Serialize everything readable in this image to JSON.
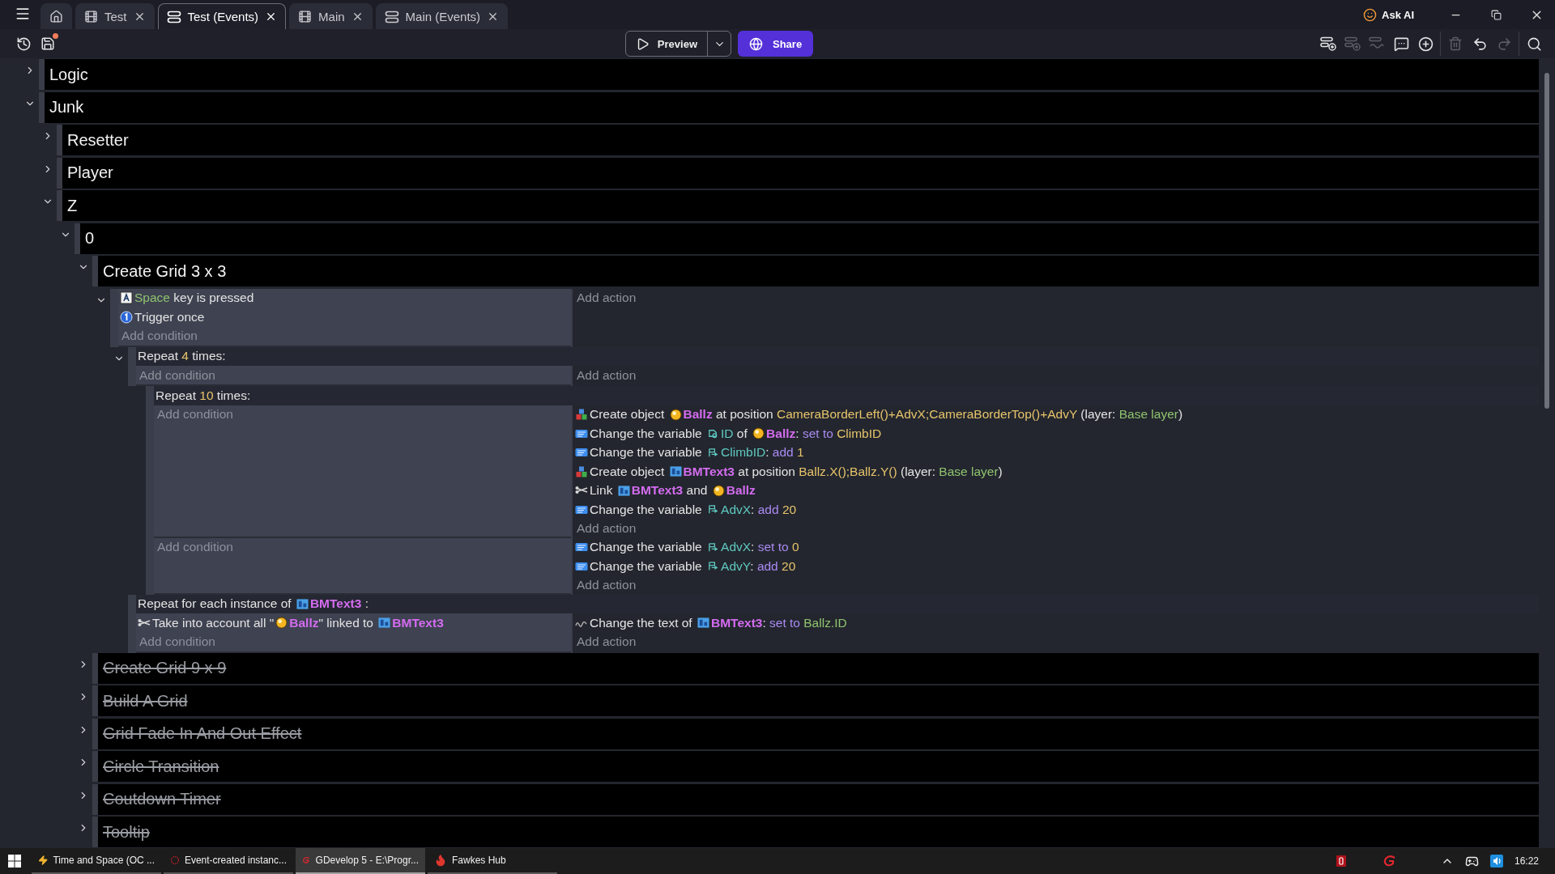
{
  "tabs": [
    {
      "kind": "home",
      "selected": false
    },
    {
      "kind": "scene",
      "label": "Test",
      "selected": false
    },
    {
      "kind": "events",
      "label": "Test (Events)",
      "selected": true
    },
    {
      "kind": "scene",
      "label": "Main",
      "selected": false
    },
    {
      "kind": "events",
      "label": "Main (Events)",
      "selected": false
    }
  ],
  "ask_ai": "Ask AI",
  "toolbar": {
    "unsaved": true,
    "preview": "Preview",
    "share": "Share",
    "tool_groups": [
      [
        {
          "kind": "add-event",
          "disabled": false
        },
        {
          "kind": "add-subevent",
          "disabled": true
        },
        {
          "kind": "add-other",
          "disabled": true
        },
        {
          "kind": "comment",
          "disabled": false
        },
        {
          "kind": "add",
          "disabled": false
        }
      ],
      [
        {
          "kind": "delete",
          "disabled": true
        },
        {
          "kind": "undo",
          "disabled": false
        },
        {
          "kind": "redo",
          "disabled": true
        }
      ],
      [
        {
          "kind": "search",
          "disabled": false
        }
      ]
    ]
  },
  "events": [
    {
      "kind": "group",
      "name": "Logic",
      "expanded": false,
      "disabled": false
    },
    {
      "kind": "group",
      "name": "Junk",
      "expanded": true,
      "disabled": false,
      "children": [
        {
          "kind": "group",
          "name": "Resetter",
          "expanded": false,
          "disabled": false
        },
        {
          "kind": "group",
          "name": "Player",
          "expanded": false,
          "disabled": false
        },
        {
          "kind": "group",
          "name": "Z",
          "expanded": true,
          "disabled": false,
          "children": [
            {
              "kind": "group",
              "name": "0",
              "expanded": true,
              "disabled": false,
              "children": [
                {
                  "kind": "group",
                  "name": "Create Grid 3 x 3",
                  "expanded": true,
                  "disabled": false,
                  "children": [
                    {
                      "kind": "event",
                      "expanded": true,
                      "add_condition": "Add condition",
                      "add_action": "Add action",
                      "conditions": [
                        {
                          "kind": "key",
                          "parts": [
                            {
                              "kind": "literal",
                              "text": "Space"
                            },
                            {
                              "kind": "text",
                              "text": " key is pressed"
                            }
                          ]
                        },
                        {
                          "kind": "trigger",
                          "parts": [
                            {
                              "kind": "text",
                              "text": "Trigger once"
                            }
                          ]
                        }
                      ],
                      "children": [
                        {
                          "kind": "event",
                          "expanded": true,
                          "add_condition": "Add condition",
                          "add_action": "Add action",
                          "header": [
                            {
                              "kind": "text",
                              "text": "Repeat "
                            },
                            {
                              "kind": "number",
                              "text": "4"
                            },
                            {
                              "kind": "text",
                              "text": " times:"
                            }
                          ],
                          "children": [
                            {
                              "kind": "event",
                              "add_condition": "Add condition",
                              "add_action": "Add action",
                              "header": [
                                {
                                  "kind": "text",
                                  "text": "Repeat "
                                },
                                {
                                  "kind": "number",
                                  "text": "10"
                                },
                                {
                                  "kind": "text",
                                  "text": " times:"
                                }
                              ],
                              "actions": [
                                {
                                  "kind": "create",
                                  "parts": [
                                    {
                                      "kind": "text",
                                      "text": "Create object "
                                    },
                                    {
                                      "kind": "sprite",
                                      "text": "Ballz"
                                    },
                                    {
                                      "kind": "text",
                                      "text": " at position "
                                    },
                                    {
                                      "kind": "expression",
                                      "text": "CameraBorderLeft()+AdvX;CameraBorderTop()+AdvY"
                                    },
                                    {
                                      "kind": "text",
                                      "text": " (layer: "
                                    },
                                    {
                                      "kind": "literal",
                                      "text": "Base layer"
                                    },
                                    {
                                      "kind": "text",
                                      "text": ")"
                                    }
                                  ]
                                },
                                {
                                  "kind": "variable",
                                  "parts": [
                                    {
                                      "kind": "text",
                                      "text": "Change the variable "
                                    },
                                    {
                                      "kind": "objvar",
                                      "text": "ID"
                                    },
                                    {
                                      "kind": "text",
                                      "text": " of "
                                    },
                                    {
                                      "kind": "sprite",
                                      "text": "Ballz"
                                    },
                                    {
                                      "kind": "text",
                                      "text": ": "
                                    },
                                    {
                                      "kind": "operator",
                                      "text": "set to "
                                    },
                                    {
                                      "kind": "expression",
                                      "text": "ClimbID"
                                    }
                                  ]
                                },
                                {
                                  "kind": "variable",
                                  "parts": [
                                    {
                                      "kind": "text",
                                      "text": "Change the variable "
                                    },
                                    {
                                      "kind": "scenevar",
                                      "text": "ClimbID"
                                    },
                                    {
                                      "kind": "text",
                                      "text": ": "
                                    },
                                    {
                                      "kind": "operator",
                                      "text": "add "
                                    },
                                    {
                                      "kind": "number",
                                      "text": "1"
                                    }
                                  ]
                                },
                                {
                                  "kind": "create",
                                  "parts": [
                                    {
                                      "kind": "text",
                                      "text": "Create object "
                                    },
                                    {
                                      "kind": "bmtext",
                                      "text": "BMText3"
                                    },
                                    {
                                      "kind": "text",
                                      "text": " at position "
                                    },
                                    {
                                      "kind": "expression",
                                      "text": "Ballz.X();Ballz.Y()"
                                    },
                                    {
                                      "kind": "text",
                                      "text": " (layer: "
                                    },
                                    {
                                      "kind": "literal",
                                      "text": "Base layer"
                                    },
                                    {
                                      "kind": "text",
                                      "text": ")"
                                    }
                                  ]
                                },
                                {
                                  "kind": "link",
                                  "parts": [
                                    {
                                      "kind": "text",
                                      "text": "Link "
                                    },
                                    {
                                      "kind": "bmtext",
                                      "text": "BMText3"
                                    },
                                    {
                                      "kind": "text",
                                      "text": " and "
                                    },
                                    {
                                      "kind": "sprite",
                                      "text": "Ballz"
                                    }
                                  ]
                                },
                                {
                                  "kind": "variable",
                                  "parts": [
                                    {
                                      "kind": "text",
                                      "text": "Change the variable "
                                    },
                                    {
                                      "kind": "scenevar",
                                      "text": "AdvX"
                                    },
                                    {
                                      "kind": "text",
                                      "text": ": "
                                    },
                                    {
                                      "kind": "operator",
                                      "text": "add "
                                    },
                                    {
                                      "kind": "number",
                                      "text": "20"
                                    }
                                  ]
                                }
                              ]
                            },
                            {
                              "kind": "event",
                              "add_condition": "Add condition",
                              "add_action": "Add action",
                              "actions": [
                                {
                                  "kind": "variable",
                                  "parts": [
                                    {
                                      "kind": "text",
                                      "text": "Change the variable "
                                    },
                                    {
                                      "kind": "scenevar",
                                      "text": "AdvX"
                                    },
                                    {
                                      "kind": "text",
                                      "text": ": "
                                    },
                                    {
                                      "kind": "operator",
                                      "text": "set to "
                                    },
                                    {
                                      "kind": "number",
                                      "text": "0"
                                    }
                                  ]
                                },
                                {
                                  "kind": "variable",
                                  "parts": [
                                    {
                                      "kind": "text",
                                      "text": "Change the variable "
                                    },
                                    {
                                      "kind": "scenevar",
                                      "text": "AdvY"
                                    },
                                    {
                                      "kind": "text",
                                      "text": ": "
                                    },
                                    {
                                      "kind": "operator",
                                      "text": "add "
                                    },
                                    {
                                      "kind": "number",
                                      "text": "20"
                                    }
                                  ]
                                }
                              ]
                            }
                          ]
                        },
                        {
                          "kind": "event",
                          "add_condition": "Add condition",
                          "add_action": "Add action",
                          "header": [
                            {
                              "kind": "text",
                              "text": "Repeat for each instance of "
                            },
                            {
                              "kind": "bmtext",
                              "text": "BMText3"
                            },
                            {
                              "kind": "text",
                              "text": " :"
                            }
                          ],
                          "conditions": [
                            {
                              "kind": "link",
                              "parts": [
                                {
                                  "kind": "text",
                                  "text": "Take into account all \""
                                },
                                {
                                  "kind": "sprite",
                                  "text": "Ballz"
                                },
                                {
                                  "kind": "text",
                                  "text": "\" linked to "
                                },
                                {
                                  "kind": "bmtext",
                                  "text": "BMText3"
                                }
                              ]
                            }
                          ],
                          "actions": [
                            {
                              "kind": "text",
                              "parts": [
                                {
                                  "kind": "text",
                                  "text": "Change the text of "
                                },
                                {
                                  "kind": "bmtext",
                                  "text": "BMText3"
                                },
                                {
                                  "kind": "text",
                                  "text": ": "
                                },
                                {
                                  "kind": "operator",
                                  "text": "set to "
                                },
                                {
                                  "kind": "literal",
                                  "text": "Ballz.ID"
                                }
                              ]
                            }
                          ]
                        }
                      ]
                    }
                  ]
                },
                {
                  "kind": "group",
                  "name": "Create Grid 9 x 9",
                  "expanded": false,
                  "disabled": true
                },
                {
                  "kind": "group",
                  "name": "Build A Grid",
                  "expanded": false,
                  "disabled": true
                },
                {
                  "kind": "group",
                  "name": "Grid Fade In And Out Effect",
                  "expanded": false,
                  "disabled": true
                },
                {
                  "kind": "group",
                  "name": "Circle Transition",
                  "expanded": false,
                  "disabled": true
                },
                {
                  "kind": "group",
                  "name": "Coutdown Timer",
                  "expanded": false,
                  "disabled": true
                },
                {
                  "kind": "group",
                  "name": "Tooltip",
                  "expanded": false,
                  "disabled": true
                }
              ]
            }
          ]
        }
      ]
    }
  ],
  "taskbar": {
    "apps": [
      {
        "kind": "bolt",
        "label": "Time and Space (OC ...",
        "selected": false
      },
      {
        "kind": "ring",
        "label": "Event-created instanc...",
        "selected": false
      },
      {
        "kind": "gdevelop",
        "label": "GDevelop 5 - E:\\Progr...",
        "selected": true
      },
      {
        "kind": "flame",
        "label": "Fawkes Hub",
        "selected": false
      }
    ],
    "time": "16:22"
  }
}
